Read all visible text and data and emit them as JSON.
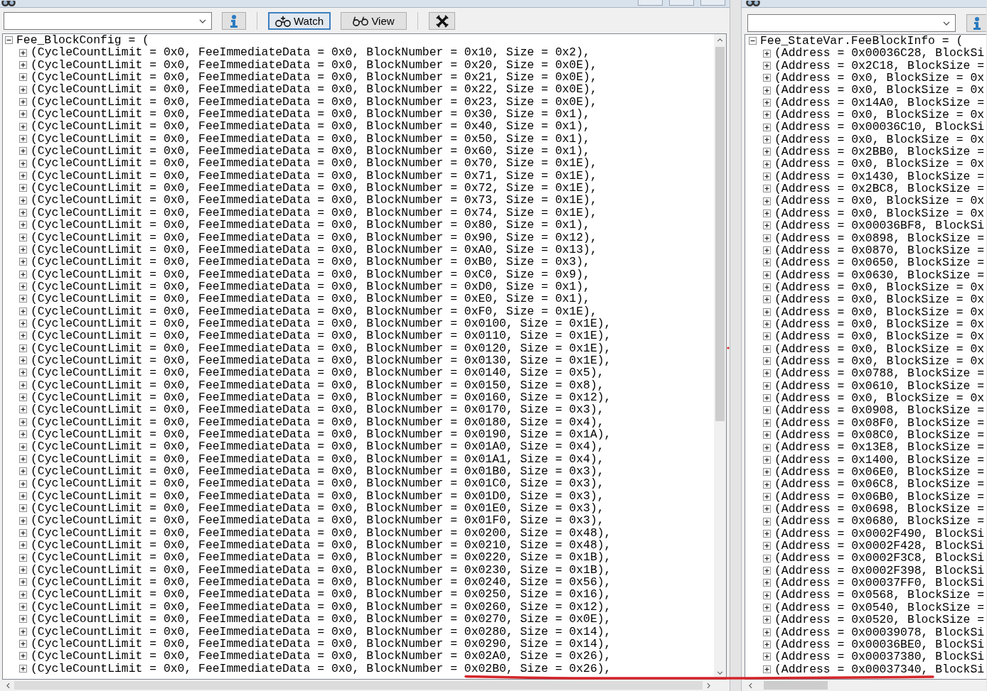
{
  "windows": [
    {
      "toolbar": [
        {
          "kind": "info"
        },
        {
          "kind": "separator"
        },
        {
          "kind": "watch",
          "label": "Watch",
          "focused": true
        },
        {
          "kind": "view",
          "label": "View",
          "focused": false
        },
        {
          "kind": "separator"
        },
        {
          "kind": "cross"
        }
      ],
      "tree": {
        "label": "Fee_BlockConfig = (",
        "expanded": true,
        "children": [
          {
            "label": "(CycleCountLimit = 0x0, FeeImmediateData = 0x0, BlockNumber = 0x10, Size = 0x2),",
            "expanded": false
          },
          {
            "label": "(CycleCountLimit = 0x0, FeeImmediateData = 0x0, BlockNumber = 0x20, Size = 0x0E),",
            "expanded": false
          },
          {
            "label": "(CycleCountLimit = 0x0, FeeImmediateData = 0x0, BlockNumber = 0x21, Size = 0x0E),",
            "expanded": false
          },
          {
            "label": "(CycleCountLimit = 0x0, FeeImmediateData = 0x0, BlockNumber = 0x22, Size = 0x0E),",
            "expanded": false
          },
          {
            "label": "(CycleCountLimit = 0x0, FeeImmediateData = 0x0, BlockNumber = 0x23, Size = 0x0E),",
            "expanded": false
          },
          {
            "label": "(CycleCountLimit = 0x0, FeeImmediateData = 0x0, BlockNumber = 0x30, Size = 0x1),",
            "expanded": false
          },
          {
            "label": "(CycleCountLimit = 0x0, FeeImmediateData = 0x0, BlockNumber = 0x40, Size = 0x1),",
            "expanded": false
          },
          {
            "label": "(CycleCountLimit = 0x0, FeeImmediateData = 0x0, BlockNumber = 0x50, Size = 0x1),",
            "expanded": false
          },
          {
            "label": "(CycleCountLimit = 0x0, FeeImmediateData = 0x0, BlockNumber = 0x60, Size = 0x1),",
            "expanded": false
          },
          {
            "label": "(CycleCountLimit = 0x0, FeeImmediateData = 0x0, BlockNumber = 0x70, Size = 0x1E),",
            "expanded": false
          },
          {
            "label": "(CycleCountLimit = 0x0, FeeImmediateData = 0x0, BlockNumber = 0x71, Size = 0x1E),",
            "expanded": false
          },
          {
            "label": "(CycleCountLimit = 0x0, FeeImmediateData = 0x0, BlockNumber = 0x72, Size = 0x1E),",
            "expanded": false
          },
          {
            "label": "(CycleCountLimit = 0x0, FeeImmediateData = 0x0, BlockNumber = 0x73, Size = 0x1E),",
            "expanded": false
          },
          {
            "label": "(CycleCountLimit = 0x0, FeeImmediateData = 0x0, BlockNumber = 0x74, Size = 0x1E),",
            "expanded": false
          },
          {
            "label": "(CycleCountLimit = 0x0, FeeImmediateData = 0x0, BlockNumber = 0x80, Size = 0x1),",
            "expanded": false
          },
          {
            "label": "(CycleCountLimit = 0x0, FeeImmediateData = 0x0, BlockNumber = 0x90, Size = 0x12),",
            "expanded": false
          },
          {
            "label": "(CycleCountLimit = 0x0, FeeImmediateData = 0x0, BlockNumber = 0xA0, Size = 0x13),",
            "expanded": false
          },
          {
            "label": "(CycleCountLimit = 0x0, FeeImmediateData = 0x0, BlockNumber = 0xB0, Size = 0x3),",
            "expanded": false
          },
          {
            "label": "(CycleCountLimit = 0x0, FeeImmediateData = 0x0, BlockNumber = 0xC0, Size = 0x9),",
            "expanded": false
          },
          {
            "label": "(CycleCountLimit = 0x0, FeeImmediateData = 0x0, BlockNumber = 0xD0, Size = 0x1),",
            "expanded": false
          },
          {
            "label": "(CycleCountLimit = 0x0, FeeImmediateData = 0x0, BlockNumber = 0xE0, Size = 0x1),",
            "expanded": false
          },
          {
            "label": "(CycleCountLimit = 0x0, FeeImmediateData = 0x0, BlockNumber = 0xF0, Size = 0x1E),",
            "expanded": false
          },
          {
            "label": "(CycleCountLimit = 0x0, FeeImmediateData = 0x0, BlockNumber = 0x0100, Size = 0x1E),",
            "expanded": false
          },
          {
            "label": "(CycleCountLimit = 0x0, FeeImmediateData = 0x0, BlockNumber = 0x0110, Size = 0x1E),",
            "expanded": false
          },
          {
            "label": "(CycleCountLimit = 0x0, FeeImmediateData = 0x0, BlockNumber = 0x0120, Size = 0x1E),",
            "expanded": false
          },
          {
            "label": "(CycleCountLimit = 0x0, FeeImmediateData = 0x0, BlockNumber = 0x0130, Size = 0x1E),",
            "expanded": false
          },
          {
            "label": "(CycleCountLimit = 0x0, FeeImmediateData = 0x0, BlockNumber = 0x0140, Size = 0x5),",
            "expanded": false
          },
          {
            "label": "(CycleCountLimit = 0x0, FeeImmediateData = 0x0, BlockNumber = 0x0150, Size = 0x8),",
            "expanded": false
          },
          {
            "label": "(CycleCountLimit = 0x0, FeeImmediateData = 0x0, BlockNumber = 0x0160, Size = 0x12),",
            "expanded": false
          },
          {
            "label": "(CycleCountLimit = 0x0, FeeImmediateData = 0x0, BlockNumber = 0x0170, Size = 0x3),",
            "expanded": false
          },
          {
            "label": "(CycleCountLimit = 0x0, FeeImmediateData = 0x0, BlockNumber = 0x0180, Size = 0x4),",
            "expanded": false
          },
          {
            "label": "(CycleCountLimit = 0x0, FeeImmediateData = 0x0, BlockNumber = 0x0190, Size = 0x1A),",
            "expanded": false
          },
          {
            "label": "(CycleCountLimit = 0x0, FeeImmediateData = 0x0, BlockNumber = 0x01A0, Size = 0x4),",
            "expanded": false
          },
          {
            "label": "(CycleCountLimit = 0x0, FeeImmediateData = 0x0, BlockNumber = 0x01A1, Size = 0x4),",
            "expanded": false
          },
          {
            "label": "(CycleCountLimit = 0x0, FeeImmediateData = 0x0, BlockNumber = 0x01B0, Size = 0x3),",
            "expanded": false
          },
          {
            "label": "(CycleCountLimit = 0x0, FeeImmediateData = 0x0, BlockNumber = 0x01C0, Size = 0x3),",
            "expanded": false
          },
          {
            "label": "(CycleCountLimit = 0x0, FeeImmediateData = 0x0, BlockNumber = 0x01D0, Size = 0x3),",
            "expanded": false
          },
          {
            "label": "(CycleCountLimit = 0x0, FeeImmediateData = 0x0, BlockNumber = 0x01E0, Size = 0x3),",
            "expanded": false
          },
          {
            "label": "(CycleCountLimit = 0x0, FeeImmediateData = 0x0, BlockNumber = 0x01F0, Size = 0x3),",
            "expanded": false
          },
          {
            "label": "(CycleCountLimit = 0x0, FeeImmediateData = 0x0, BlockNumber = 0x0200, Size = 0x48),",
            "expanded": false
          },
          {
            "label": "(CycleCountLimit = 0x0, FeeImmediateData = 0x0, BlockNumber = 0x0210, Size = 0x48),",
            "expanded": false
          },
          {
            "label": "(CycleCountLimit = 0x0, FeeImmediateData = 0x0, BlockNumber = 0x0220, Size = 0x1B),",
            "expanded": false
          },
          {
            "label": "(CycleCountLimit = 0x0, FeeImmediateData = 0x0, BlockNumber = 0x0230, Size = 0x1B),",
            "expanded": false
          },
          {
            "label": "(CycleCountLimit = 0x0, FeeImmediateData = 0x0, BlockNumber = 0x0240, Size = 0x56),",
            "expanded": false
          },
          {
            "label": "(CycleCountLimit = 0x0, FeeImmediateData = 0x0, BlockNumber = 0x0250, Size = 0x16),",
            "expanded": false
          },
          {
            "label": "(CycleCountLimit = 0x0, FeeImmediateData = 0x0, BlockNumber = 0x0260, Size = 0x12),",
            "expanded": false
          },
          {
            "label": "(CycleCountLimit = 0x0, FeeImmediateData = 0x0, BlockNumber = 0x0270, Size = 0x0E),",
            "expanded": false
          },
          {
            "label": "(CycleCountLimit = 0x0, FeeImmediateData = 0x0, BlockNumber = 0x0280, Size = 0x14),",
            "expanded": false
          },
          {
            "label": "(CycleCountLimit = 0x0, FeeImmediateData = 0x0, BlockNumber = 0x0290, Size = 0x14),",
            "expanded": false
          },
          {
            "label": "(CycleCountLimit = 0x0, FeeImmediateData = 0x0, BlockNumber = 0x02A0, Size = 0x26),",
            "expanded": false
          },
          {
            "label": "(CycleCountLimit = 0x0, FeeImmediateData = 0x0, BlockNumber = 0x02B0, Size = 0x26),",
            "expanded": false
          }
        ]
      }
    },
    {
      "toolbar": [
        {
          "kind": "info"
        }
      ],
      "tree": {
        "label": "Fee_StateVar.FeeBlockInfo = (",
        "expanded": true,
        "children": [
          {
            "label": "(Address = 0x00036C28, BlockSi",
            "expanded": false
          },
          {
            "label": "(Address = 0x2C18, BlockSize =",
            "expanded": false
          },
          {
            "label": "(Address = 0x0, BlockSize = 0x",
            "expanded": false
          },
          {
            "label": "(Address = 0x0, BlockSize = 0x",
            "expanded": false
          },
          {
            "label": "(Address = 0x14A0, BlockSize =",
            "expanded": false
          },
          {
            "label": "(Address = 0x0, BlockSize = 0x",
            "expanded": false
          },
          {
            "label": "(Address = 0x00036C10, BlockSi",
            "expanded": false
          },
          {
            "label": "(Address = 0x0, BlockSize = 0x",
            "expanded": false
          },
          {
            "label": "(Address = 0x2BB0, BlockSize =",
            "expanded": false
          },
          {
            "label": "(Address = 0x0, BlockSize = 0x",
            "expanded": false
          },
          {
            "label": "(Address = 0x1430, BlockSize =",
            "expanded": false
          },
          {
            "label": "(Address = 0x2BC8, BlockSize =",
            "expanded": false
          },
          {
            "label": "(Address = 0x0, BlockSize = 0x",
            "expanded": false
          },
          {
            "label": "(Address = 0x0, BlockSize = 0x",
            "expanded": false
          },
          {
            "label": "(Address = 0x00036BF8, BlockSi",
            "expanded": false
          },
          {
            "label": "(Address = 0x0898, BlockSize =",
            "expanded": false
          },
          {
            "label": "(Address = 0x0870, BlockSize =",
            "expanded": false
          },
          {
            "label": "(Address = 0x0650, BlockSize =",
            "expanded": false
          },
          {
            "label": "(Address = 0x0630, BlockSize =",
            "expanded": false
          },
          {
            "label": "(Address = 0x0, BlockSize = 0x",
            "expanded": false
          },
          {
            "label": "(Address = 0x0, BlockSize = 0x",
            "expanded": false
          },
          {
            "label": "(Address = 0x0, BlockSize = 0x",
            "expanded": false
          },
          {
            "label": "(Address = 0x0, BlockSize = 0x",
            "expanded": false
          },
          {
            "label": "(Address = 0x0, BlockSize = 0x",
            "expanded": false
          },
          {
            "label": "(Address = 0x0, BlockSize = 0x",
            "expanded": false
          },
          {
            "label": "(Address = 0x0, BlockSize = 0x",
            "expanded": false
          },
          {
            "label": "(Address = 0x0788, BlockSize =",
            "expanded": false
          },
          {
            "label": "(Address = 0x0610, BlockSize =",
            "expanded": false
          },
          {
            "label": "(Address = 0x0, BlockSize = 0x",
            "expanded": false
          },
          {
            "label": "(Address = 0x0908, BlockSize =",
            "expanded": false
          },
          {
            "label": "(Address = 0x08F0, BlockSize =",
            "expanded": false
          },
          {
            "label": "(Address = 0x08C0, BlockSize =",
            "expanded": false
          },
          {
            "label": "(Address = 0x13E8, BlockSize =",
            "expanded": false
          },
          {
            "label": "(Address = 0x1400, BlockSize =",
            "expanded": false
          },
          {
            "label": "(Address = 0x06E0, BlockSize =",
            "expanded": false
          },
          {
            "label": "(Address = 0x06C8, BlockSize =",
            "expanded": false
          },
          {
            "label": "(Address = 0x06B0, BlockSize =",
            "expanded": false
          },
          {
            "label": "(Address = 0x0698, BlockSize =",
            "expanded": false
          },
          {
            "label": "(Address = 0x0680, BlockSize =",
            "expanded": false
          },
          {
            "label": "(Address = 0x0002F490, BlockSi",
            "expanded": false
          },
          {
            "label": "(Address = 0x0002F428, BlockSi",
            "expanded": false
          },
          {
            "label": "(Address = 0x0002F3C8, BlockSi",
            "expanded": false
          },
          {
            "label": "(Address = 0x0002F398, BlockSi",
            "expanded": false
          },
          {
            "label": "(Address = 0x00037FF0, BlockSi",
            "expanded": false
          },
          {
            "label": "(Address = 0x0568, BlockSize =",
            "expanded": false
          },
          {
            "label": "(Address = 0x0540, BlockSize =",
            "expanded": false
          },
          {
            "label": "(Address = 0x0520, BlockSize =",
            "expanded": false
          },
          {
            "label": "(Address = 0x00039078, BlockSi",
            "expanded": false
          },
          {
            "label": "(Address = 0x00036BE0, BlockSi",
            "expanded": false
          },
          {
            "label": "(Address = 0x00037380, BlockSi",
            "expanded": false
          },
          {
            "label": "(Address = 0x00037340, BlockSi",
            "expanded": false
          }
        ]
      }
    }
  ],
  "annotations": [
    {
      "kind": "stroke"
    },
    {
      "kind": "dot"
    }
  ]
}
